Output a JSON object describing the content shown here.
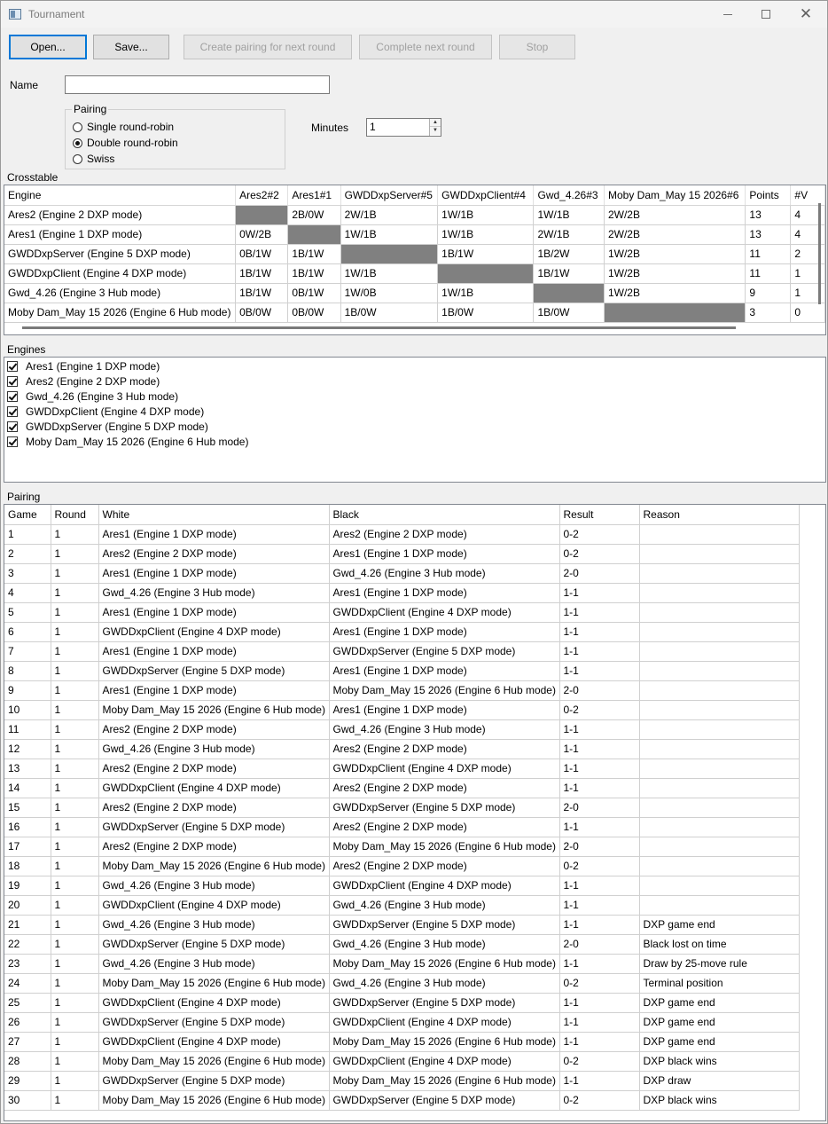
{
  "window": {
    "title": "Tournament",
    "close_glyph": "✕"
  },
  "toolbar": {
    "open_label": "Open...",
    "save_label": "Save...",
    "create_pairing_label": "Create pairing for next round",
    "complete_round_label": "Complete next round",
    "stop_label": "Stop"
  },
  "form": {
    "name_label": "Name",
    "name_value": "",
    "pairing_title": "Pairing",
    "pairing_options": [
      "Single round-robin",
      "Double round-robin",
      "Swiss"
    ],
    "pairing_selected": "Double round-robin",
    "minutes_label": "Minutes",
    "minutes_value": "1"
  },
  "crosstable": {
    "title": "Crosstable",
    "headers": [
      "Engine",
      "Ares2#2",
      "Ares1#1",
      "GWDDxpServer#5",
      "GWDDxpClient#4",
      "Gwd_4.26#3",
      "Moby Dam_May 15 2026#6",
      "Points",
      "#V"
    ],
    "rows": [
      [
        "Ares2 (Engine 2 DXP mode)",
        "",
        "2B/0W",
        "2W/1B",
        "1W/1B",
        "1W/1B",
        "2W/2B",
        "13",
        "4"
      ],
      [
        "Ares1 (Engine 1 DXP mode)",
        "0W/2B",
        "",
        "1W/1B",
        "1W/1B",
        "2W/1B",
        "2W/2B",
        "13",
        "4"
      ],
      [
        "GWDDxpServer (Engine 5 DXP mode)",
        "0B/1W",
        "1B/1W",
        "",
        "1B/1W",
        "1B/2W",
        "1W/2B",
        "11",
        "2"
      ],
      [
        "GWDDxpClient (Engine 4 DXP mode)",
        "1B/1W",
        "1B/1W",
        "1W/1B",
        "",
        "1B/1W",
        "1W/2B",
        "11",
        "1"
      ],
      [
        "Gwd_4.26 (Engine 3 Hub mode)",
        "1B/1W",
        "0B/1W",
        "1W/0B",
        "1W/1B",
        "",
        "1W/2B",
        "9",
        "1"
      ],
      [
        "Moby Dam_May 15 2026 (Engine 6 Hub mode)",
        "0B/0W",
        "0B/0W",
        "1B/0W",
        "1B/0W",
        "1B/0W",
        "",
        "3",
        "0"
      ]
    ]
  },
  "engines": {
    "title": "Engines",
    "items": [
      {
        "label": "Ares1 (Engine 1 DXP mode)",
        "checked": true
      },
      {
        "label": "Ares2 (Engine 2 DXP mode)",
        "checked": true
      },
      {
        "label": "Gwd_4.26 (Engine 3 Hub mode)",
        "checked": true
      },
      {
        "label": "GWDDxpClient (Engine 4 DXP mode)",
        "checked": true
      },
      {
        "label": "GWDDxpServer (Engine 5 DXP mode)",
        "checked": true
      },
      {
        "label": "Moby Dam_May 15 2026 (Engine 6 Hub mode)",
        "checked": true
      }
    ]
  },
  "pairing": {
    "title": "Pairing",
    "headers": [
      "Game",
      "Round",
      "White",
      "Black",
      "Result",
      "Reason"
    ],
    "rows": [
      [
        "1",
        "1",
        "Ares1 (Engine 1 DXP mode)",
        "Ares2 (Engine 2 DXP mode)",
        "0-2",
        ""
      ],
      [
        "2",
        "1",
        "Ares2 (Engine 2 DXP mode)",
        "Ares1 (Engine 1 DXP mode)",
        "0-2",
        ""
      ],
      [
        "3",
        "1",
        "Ares1 (Engine 1 DXP mode)",
        "Gwd_4.26 (Engine 3 Hub mode)",
        "2-0",
        ""
      ],
      [
        "4",
        "1",
        "Gwd_4.26 (Engine 3 Hub mode)",
        "Ares1 (Engine 1 DXP mode)",
        "1-1",
        ""
      ],
      [
        "5",
        "1",
        "Ares1 (Engine 1 DXP mode)",
        "GWDDxpClient (Engine 4 DXP mode)",
        "1-1",
        ""
      ],
      [
        "6",
        "1",
        "GWDDxpClient (Engine 4 DXP mode)",
        "Ares1 (Engine 1 DXP mode)",
        "1-1",
        ""
      ],
      [
        "7",
        "1",
        "Ares1 (Engine 1 DXP mode)",
        "GWDDxpServer (Engine 5 DXP mode)",
        "1-1",
        ""
      ],
      [
        "8",
        "1",
        "GWDDxpServer (Engine 5 DXP mode)",
        "Ares1 (Engine 1 DXP mode)",
        "1-1",
        ""
      ],
      [
        "9",
        "1",
        "Ares1 (Engine 1 DXP mode)",
        "Moby Dam_May 15 2026 (Engine 6 Hub mode)",
        "2-0",
        ""
      ],
      [
        "10",
        "1",
        "Moby Dam_May 15 2026 (Engine 6 Hub mode)",
        "Ares1 (Engine 1 DXP mode)",
        "0-2",
        ""
      ],
      [
        "11",
        "1",
        "Ares2 (Engine 2 DXP mode)",
        "Gwd_4.26 (Engine 3 Hub mode)",
        "1-1",
        ""
      ],
      [
        "12",
        "1",
        "Gwd_4.26 (Engine 3 Hub mode)",
        "Ares2 (Engine 2 DXP mode)",
        "1-1",
        ""
      ],
      [
        "13",
        "1",
        "Ares2 (Engine 2 DXP mode)",
        "GWDDxpClient (Engine 4 DXP mode)",
        "1-1",
        ""
      ],
      [
        "14",
        "1",
        "GWDDxpClient (Engine 4 DXP mode)",
        "Ares2 (Engine 2 DXP mode)",
        "1-1",
        ""
      ],
      [
        "15",
        "1",
        "Ares2 (Engine 2 DXP mode)",
        "GWDDxpServer (Engine 5 DXP mode)",
        "2-0",
        ""
      ],
      [
        "16",
        "1",
        "GWDDxpServer (Engine 5 DXP mode)",
        "Ares2 (Engine 2 DXP mode)",
        "1-1",
        ""
      ],
      [
        "17",
        "1",
        "Ares2 (Engine 2 DXP mode)",
        "Moby Dam_May 15 2026 (Engine 6 Hub mode)",
        "2-0",
        ""
      ],
      [
        "18",
        "1",
        "Moby Dam_May 15 2026 (Engine 6 Hub mode)",
        "Ares2 (Engine 2 DXP mode)",
        "0-2",
        ""
      ],
      [
        "19",
        "1",
        "Gwd_4.26 (Engine 3 Hub mode)",
        "GWDDxpClient (Engine 4 DXP mode)",
        "1-1",
        ""
      ],
      [
        "20",
        "1",
        "GWDDxpClient (Engine 4 DXP mode)",
        "Gwd_4.26 (Engine 3 Hub mode)",
        "1-1",
        ""
      ],
      [
        "21",
        "1",
        "Gwd_4.26 (Engine 3 Hub mode)",
        "GWDDxpServer (Engine 5 DXP mode)",
        "1-1",
        "DXP game end"
      ],
      [
        "22",
        "1",
        "GWDDxpServer (Engine 5 DXP mode)",
        "Gwd_4.26 (Engine 3 Hub mode)",
        "2-0",
        "Black lost on time"
      ],
      [
        "23",
        "1",
        "Gwd_4.26 (Engine 3 Hub mode)",
        "Moby Dam_May 15 2026 (Engine 6 Hub mode)",
        "1-1",
        "Draw by 25-move rule"
      ],
      [
        "24",
        "1",
        "Moby Dam_May 15 2026 (Engine 6 Hub mode)",
        "Gwd_4.26 (Engine 3 Hub mode)",
        "0-2",
        "Terminal position"
      ],
      [
        "25",
        "1",
        "GWDDxpClient (Engine 4 DXP mode)",
        "GWDDxpServer (Engine 5 DXP mode)",
        "1-1",
        "DXP game end"
      ],
      [
        "26",
        "1",
        "GWDDxpServer (Engine 5 DXP mode)",
        "GWDDxpClient (Engine 4 DXP mode)",
        "1-1",
        "DXP game end"
      ],
      [
        "27",
        "1",
        "GWDDxpClient (Engine 4 DXP mode)",
        "Moby Dam_May 15 2026 (Engine 6 Hub mode)",
        "1-1",
        "DXP game end"
      ],
      [
        "28",
        "1",
        "Moby Dam_May 15 2026 (Engine 6 Hub mode)",
        "GWDDxpClient (Engine 4 DXP mode)",
        "0-2",
        "DXP black wins"
      ],
      [
        "29",
        "1",
        "GWDDxpServer (Engine 5 DXP mode)",
        "Moby Dam_May 15 2026 (Engine 6 Hub mode)",
        "1-1",
        "DXP draw"
      ],
      [
        "30",
        "1",
        "Moby Dam_May 15 2026 (Engine 6 Hub mode)",
        "GWDDxpServer (Engine 5 DXP mode)",
        "0-2",
        "DXP black wins"
      ]
    ]
  }
}
